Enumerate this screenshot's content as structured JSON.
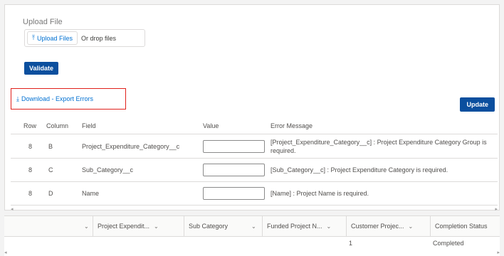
{
  "upload": {
    "label": "Upload File",
    "button_label": "Upload Files",
    "drop_text": "Or drop files"
  },
  "validate_label": "Validate",
  "download_label": "Download - Export Errors",
  "update_label": "Update",
  "errors": {
    "headers": {
      "row": "Row",
      "column": "Column",
      "field": "Field",
      "value": "Value",
      "message": "Error Message"
    },
    "rows": [
      {
        "row": "8",
        "column": "B",
        "field": "Project_Expenditure_Category__c",
        "value": "",
        "message": "[Project_Expenditure_Category__c] : Project Expenditure Category Group is required."
      },
      {
        "row": "8",
        "column": "C",
        "field": "Sub_Category__c",
        "value": "",
        "message": "[Sub_Category__c] : Project Expenditure Category is required."
      },
      {
        "row": "8",
        "column": "D",
        "field": "Name",
        "value": "",
        "message": "[Name] : Project Name is required."
      }
    ]
  },
  "grid": {
    "headers": [
      "Project Expendit...",
      "Sub Category",
      "Funded Project N...",
      "Customer Projec...",
      "Completion Status"
    ],
    "row": {
      "customer_project": "1",
      "completion_status": "Completed"
    }
  },
  "icons": {
    "upload": "upload-icon",
    "download": "download-icon",
    "chevron": "chevron-down-icon"
  },
  "colors": {
    "brand_button": "#0b4f9e",
    "link": "#0070d2",
    "highlight_border": "#e0201b"
  }
}
